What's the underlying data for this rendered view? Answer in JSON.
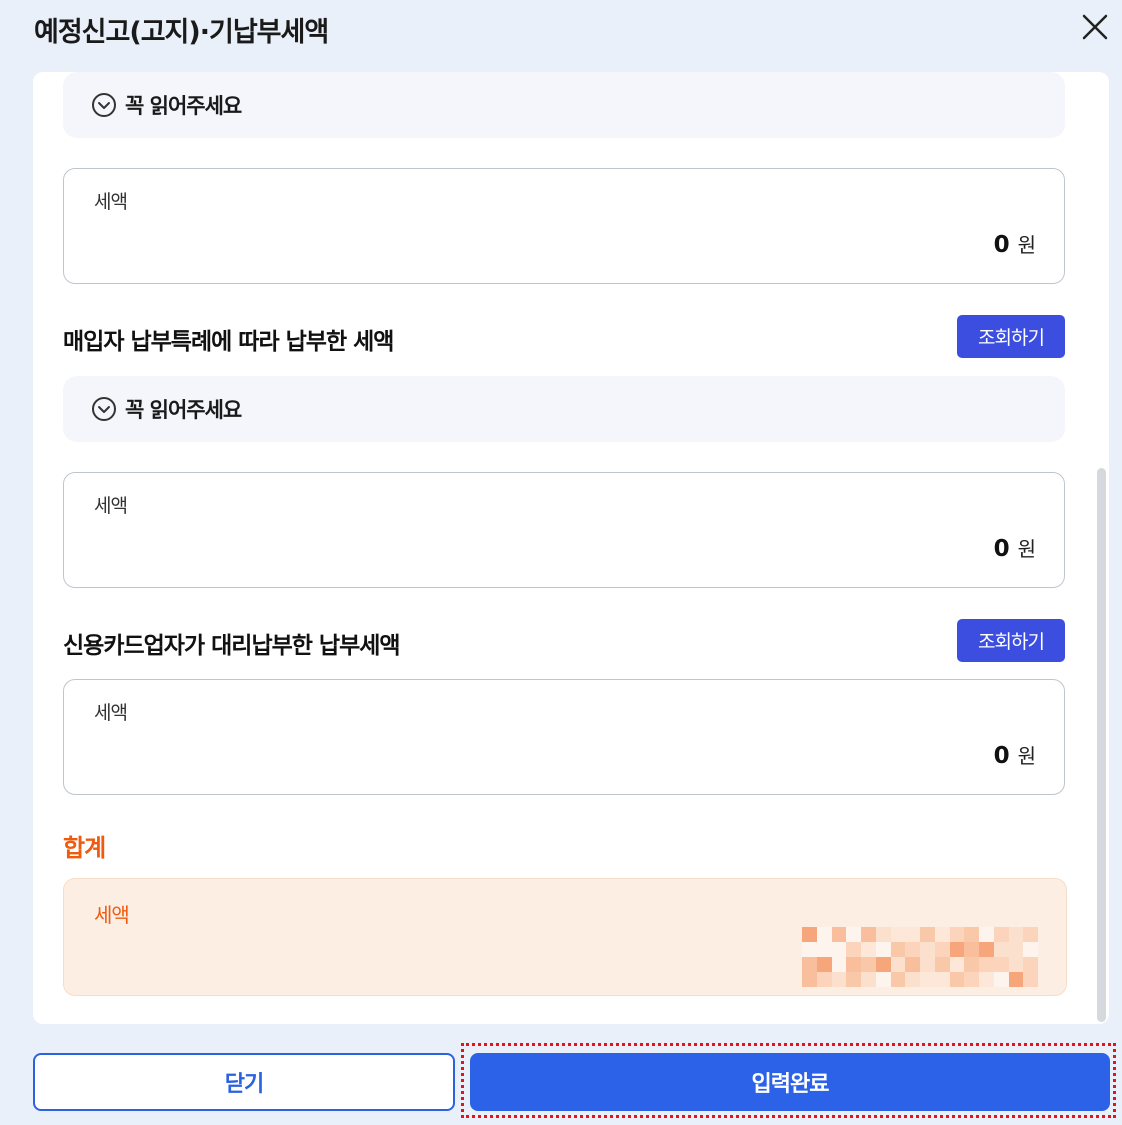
{
  "modal": {
    "title": "예정신고(고지)·기납부세액",
    "close_icon": "close-icon"
  },
  "notices": [
    {
      "label": "꼭 읽어주세요",
      "icon": "chevron-down-circle-icon"
    },
    {
      "label": "꼭 읽어주세요",
      "icon": "chevron-down-circle-icon"
    }
  ],
  "fields": [
    {
      "label": "세액",
      "value": "0",
      "unit": "원"
    },
    {
      "label": "세액",
      "value": "0",
      "unit": "원"
    },
    {
      "label": "세액",
      "value": "0",
      "unit": "원"
    }
  ],
  "sections": [
    {
      "title": "매입자 납부특례에 따라 납부한 세액",
      "button": "조회하기"
    },
    {
      "title": "신용카드업자가 대리납부한 납부세액",
      "button": "조회하기"
    }
  ],
  "total": {
    "title": "합계",
    "label": "세액",
    "value_redacted": true
  },
  "footer": {
    "close_label": "닫기",
    "submit_label": "입력완료"
  },
  "colors": {
    "accent": "#2b62e8",
    "lookup": "#3b4ee0",
    "total": "#f05a0f",
    "highlight_border": "#e3131b"
  }
}
